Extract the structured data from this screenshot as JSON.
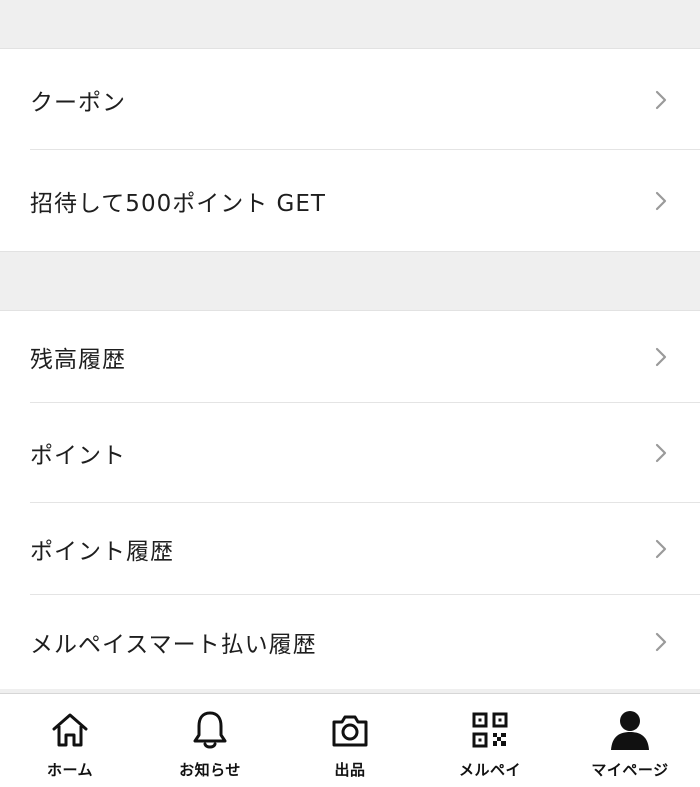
{
  "group1": {
    "items": [
      {
        "label": "クーポン"
      },
      {
        "label": "招待して500ポイント GET"
      }
    ]
  },
  "group2": {
    "items": [
      {
        "label": "残高履歴"
      },
      {
        "label": "ポイント"
      },
      {
        "label": "ポイント履歴"
      },
      {
        "label": "メルペイスマート払い履歴"
      }
    ]
  },
  "tabbar": {
    "tabs": [
      {
        "label": "ホーム",
        "icon": "home-icon"
      },
      {
        "label": "お知らせ",
        "icon": "bell-icon"
      },
      {
        "label": "出品",
        "icon": "camera-icon"
      },
      {
        "label": "メルペイ",
        "icon": "qr-code-icon"
      },
      {
        "label": "マイページ",
        "icon": "user-icon",
        "active": true
      }
    ]
  },
  "colors": {
    "background": "#efefef",
    "divider": "#e4e4e4",
    "chevron": "#9a9a9a",
    "text": "#1e1e1e"
  }
}
